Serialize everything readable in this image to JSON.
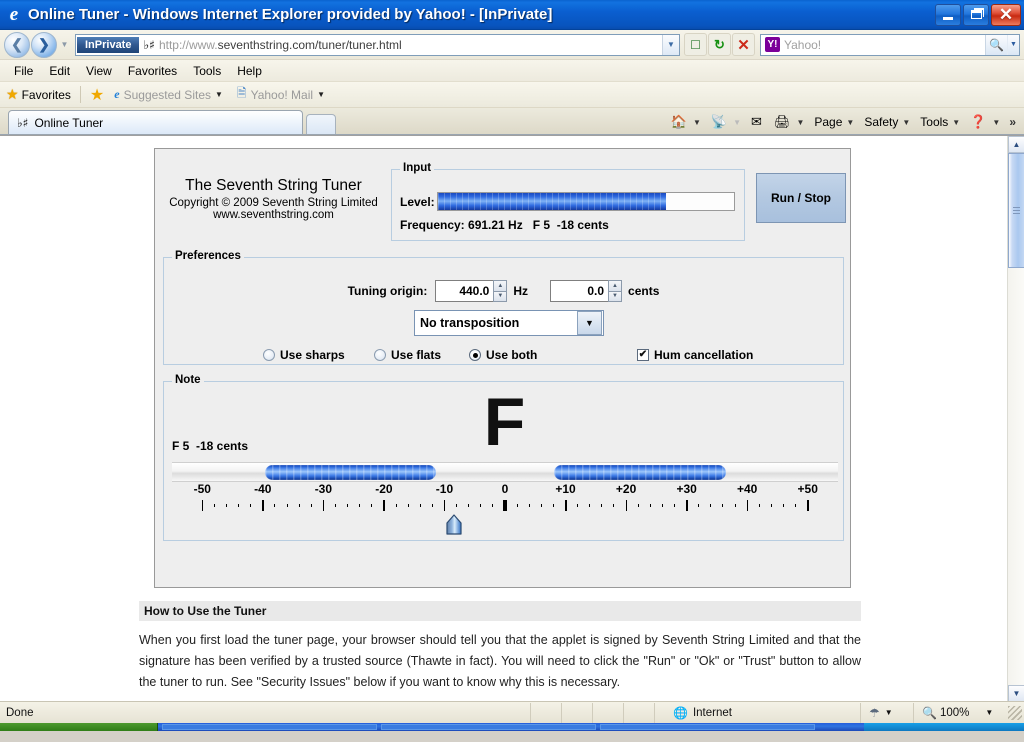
{
  "window": {
    "title": "Online Tuner - Windows Internet Explorer provided by Yahoo! - [InPrivate]",
    "ie_logo_icon": "internet-explorer-logo",
    "minimize_label": "Minimize",
    "restore_label": "Restore",
    "close_label": "Close"
  },
  "nav": {
    "back_icon": "back-arrow-icon",
    "forward_icon": "forward-arrow-icon",
    "recent_icon": "recent-pages-chevron-icon",
    "inprivate_badge": "InPrivate",
    "site_icon": "flat-sharp-music-icon",
    "url_dim": "http://www.",
    "url_main": "seventhstring.com/tuner/tuner.html",
    "address_dropdown_icon": "chevron-down-icon",
    "compat_icon": "compatibility-view-icon",
    "refresh_icon": "refresh-icon",
    "stop_icon": "stop-icon",
    "search_provider_icon": "yahoo-icon",
    "search_placeholder": "Yahoo!",
    "search_go_icon": "search-icon",
    "search_options_icon": "chevron-down-icon"
  },
  "menu": {
    "items": [
      "File",
      "Edit",
      "View",
      "Favorites",
      "Tools",
      "Help"
    ]
  },
  "favbar": {
    "star_icon": "star-icon",
    "favorites_label": "Favorites",
    "add_icon": "add-to-favorites-icon",
    "items": [
      {
        "label": "Suggested Sites",
        "icon": "internet-explorer-icon",
        "has_caret": true
      },
      {
        "label": "Yahoo! Mail",
        "icon": "page-icon",
        "has_caret": true
      }
    ]
  },
  "tabs": {
    "items": [
      {
        "label": "Online Tuner",
        "favicon": "flat-sharp-music-icon",
        "active": true
      }
    ],
    "new_tab_label": ""
  },
  "commandbar": {
    "items": [
      {
        "label": "",
        "icon": "home-icon",
        "caret": true,
        "dimmed": false
      },
      {
        "label": "",
        "icon": "feeds-icon",
        "caret": true,
        "dimmed": true
      },
      {
        "label": "",
        "icon": "read-mail-icon",
        "caret": false,
        "dimmed": false
      },
      {
        "label": "",
        "icon": "print-icon",
        "caret": true,
        "dimmed": false
      },
      {
        "label": "Page",
        "icon": "",
        "caret": true,
        "dimmed": false
      },
      {
        "label": "Safety",
        "icon": "",
        "caret": true,
        "dimmed": false
      },
      {
        "label": "Tools",
        "icon": "",
        "caret": true,
        "dimmed": false
      },
      {
        "label": "",
        "icon": "help-icon",
        "caret": true,
        "dimmed": false
      }
    ],
    "overflow_icon": "chevron-double-right-icon"
  },
  "applet": {
    "brand": {
      "line1": "The Seventh String Tuner",
      "line2": "Copyright © 2009 Seventh String Limited",
      "line3": "www.seventhstring.com"
    },
    "input": {
      "legend": "Input",
      "level_label": "Level:",
      "level_percent": 77,
      "frequency_text": "Frequency: 691.21 Hz   F 5  -18 cents"
    },
    "run_stop_label": "Run / Stop",
    "preferences": {
      "legend": "Preferences",
      "tuning_origin_label": "Tuning origin:",
      "hz_value": "440.0",
      "hz_unit": "Hz",
      "cents_value": "0.0",
      "cents_unit": "cents",
      "transposition_value": "No transposition",
      "transposition_caret_icon": "chevron-down-icon",
      "radios": [
        {
          "label": "Use sharps",
          "selected": false
        },
        {
          "label": "Use flats",
          "selected": false
        },
        {
          "label": "Use both",
          "selected": true
        }
      ],
      "hum_cancellation_label": "Hum cancellation",
      "hum_cancellation_checked": true,
      "check_glyph": "✔"
    },
    "note": {
      "legend": "Note",
      "big_note": "F",
      "note_detail": "F 5  -18 cents",
      "pointer_cents": -8.4,
      "pointer_icon": "tuning-pointer-icon"
    }
  },
  "chart_data": {
    "type": "bar",
    "title": "Cents deviation meter",
    "xlabel": "cents",
    "xlim": [
      -55,
      55
    ],
    "tick_labels": [
      "-50",
      "-40",
      "-30",
      "-20",
      "-10",
      "0",
      "+10",
      "+20",
      "+30",
      "+40",
      "+50"
    ],
    "tick_values": [
      -50,
      -40,
      -30,
      -20,
      -10,
      0,
      10,
      20,
      30,
      40,
      50
    ],
    "minor_tick_step": 2,
    "mid_tick_step": 5,
    "segments": [
      {
        "start_cents": -39.6,
        "end_cents": -11.4
      },
      {
        "start_cents": 8.1,
        "end_cents": 36.5
      },
      {
        "start_cents": 55.5,
        "end_cents": 56.0
      }
    ],
    "pointer_cents": -8.4,
    "grid": false,
    "legend": "none"
  },
  "page": {
    "howto_heading": "How to Use the Tuner",
    "paragraph": "When you first load the tuner page, your browser should tell you that the applet is signed by Seventh String Limited and that the signature has been verified by a trusted source (Thawte in fact). You will need to click the \"Run\" or \"Ok\" or \"Trust\" button to allow the tuner to run. See \"Security Issues\" below if you want to know why this is necessary."
  },
  "scrollbar": {
    "up_icon": "chevron-up-icon",
    "down_icon": "chevron-down-icon",
    "thumb_icon": "scrollbar-grip-icon"
  },
  "status": {
    "text": "Done",
    "zone_icon": "globe-icon",
    "zone_label": "Internet",
    "protected_icon": "protected-mode-icon",
    "protected_caret": "chevron-down-icon",
    "zoom_icon": "zoom-icon",
    "zoom_level": "100%",
    "zoom_caret": "chevron-down-icon",
    "resize_grip_icon": "resize-grip-icon"
  },
  "colors": {
    "titlebar_blue": "#0A5FD0",
    "accent_blue": "#3c79e6",
    "applet_bg": "#eeeeee",
    "page_bg": "#ffffff"
  }
}
